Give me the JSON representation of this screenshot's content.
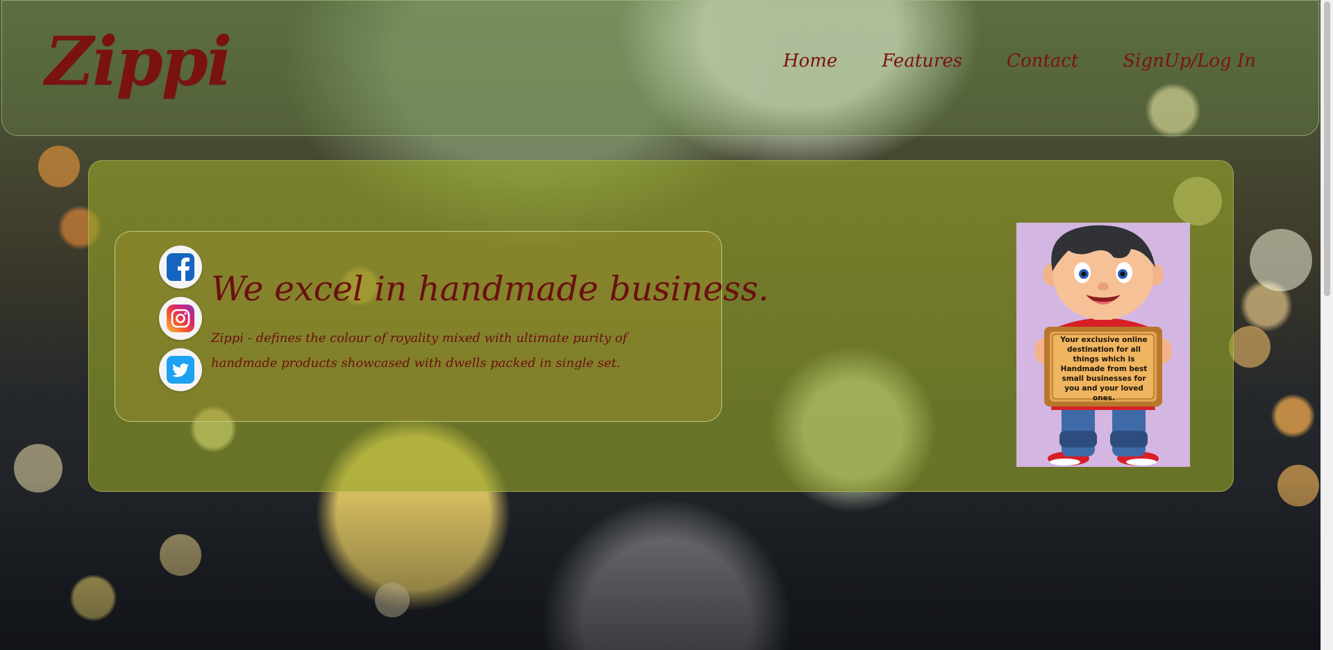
{
  "brand": {
    "logo_text": "Zippi",
    "colors": {
      "primary": "#7a1212",
      "panel": "#96a528",
      "poster_bg": "#d3b7e2"
    }
  },
  "nav": {
    "links": [
      {
        "label": "Home"
      },
      {
        "label": "Features"
      },
      {
        "label": "Contact"
      },
      {
        "label": "SignUp/Log In"
      }
    ]
  },
  "hero": {
    "headline": "We excel in handmade business.",
    "description": "Zippi - defines the colour of royality mixed with ultimate purity of handmade products showcased with dwells packed in single set.",
    "social": [
      {
        "icon": "facebook-icon"
      },
      {
        "icon": "instagram-icon"
      },
      {
        "icon": "twitter-icon"
      }
    ],
    "poster": {
      "sign_text": "Your exclusive online destination for all things which is Handmade from best small businesses for you and your loved ones."
    }
  }
}
